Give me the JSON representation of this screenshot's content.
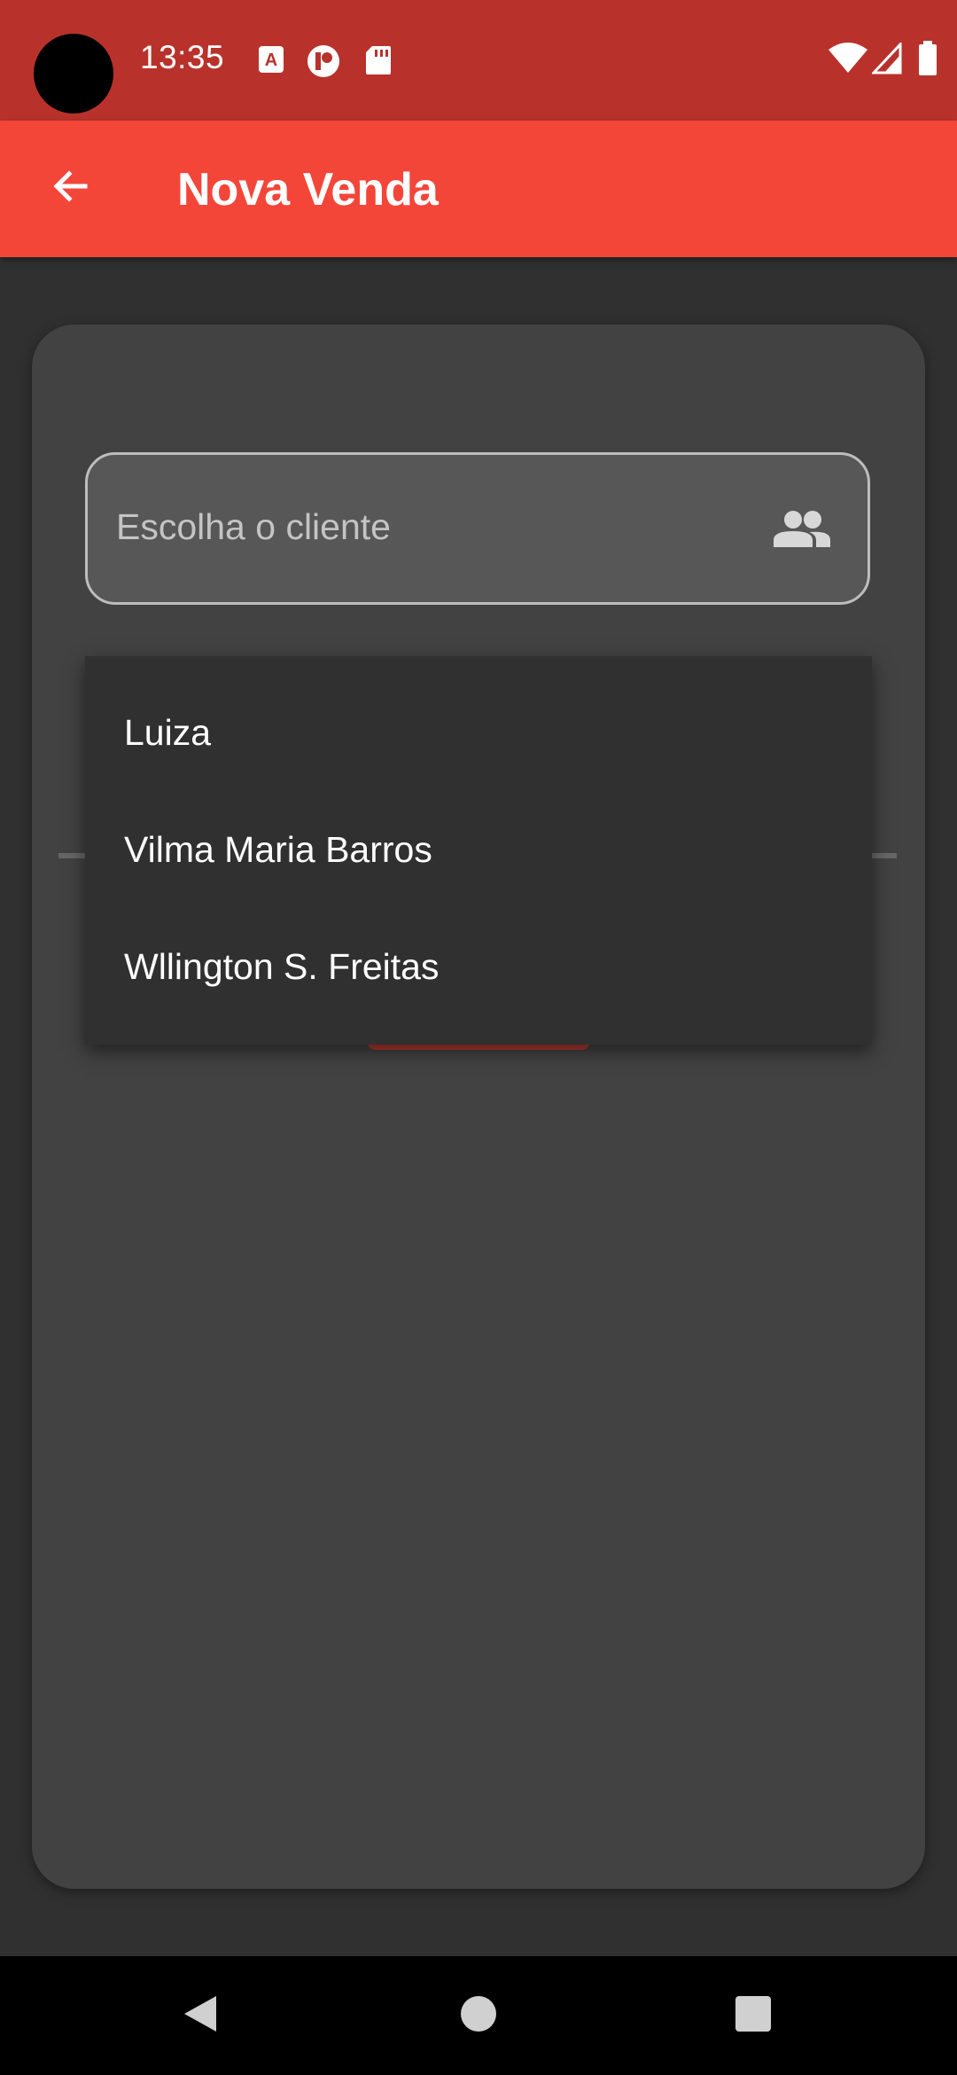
{
  "status_bar": {
    "time": "13:35",
    "left_icons": [
      "font-app-icon",
      "record-app-icon",
      "sd-card-icon"
    ],
    "right_icons": [
      "wifi-icon",
      "cell-signal-icon",
      "battery-icon"
    ]
  },
  "app_bar": {
    "title": "Nova Venda",
    "back_icon": "arrow-back-icon"
  },
  "client_field": {
    "placeholder": "Escolha o cliente",
    "icon": "people-icon"
  },
  "dropdown": {
    "items": [
      {
        "label": "Luiza"
      },
      {
        "label": "Vilma Maria Barros"
      },
      {
        "label": "Wllington S. Freitas"
      }
    ]
  },
  "nav_bar": {
    "icons": [
      "back-triangle-icon",
      "home-circle-icon",
      "recents-square-icon"
    ]
  },
  "colors": {
    "status_bar": "#b8322b",
    "app_bar": "#f44539",
    "background": "#303030",
    "card": "#424242",
    "dropdown": "#303030"
  }
}
